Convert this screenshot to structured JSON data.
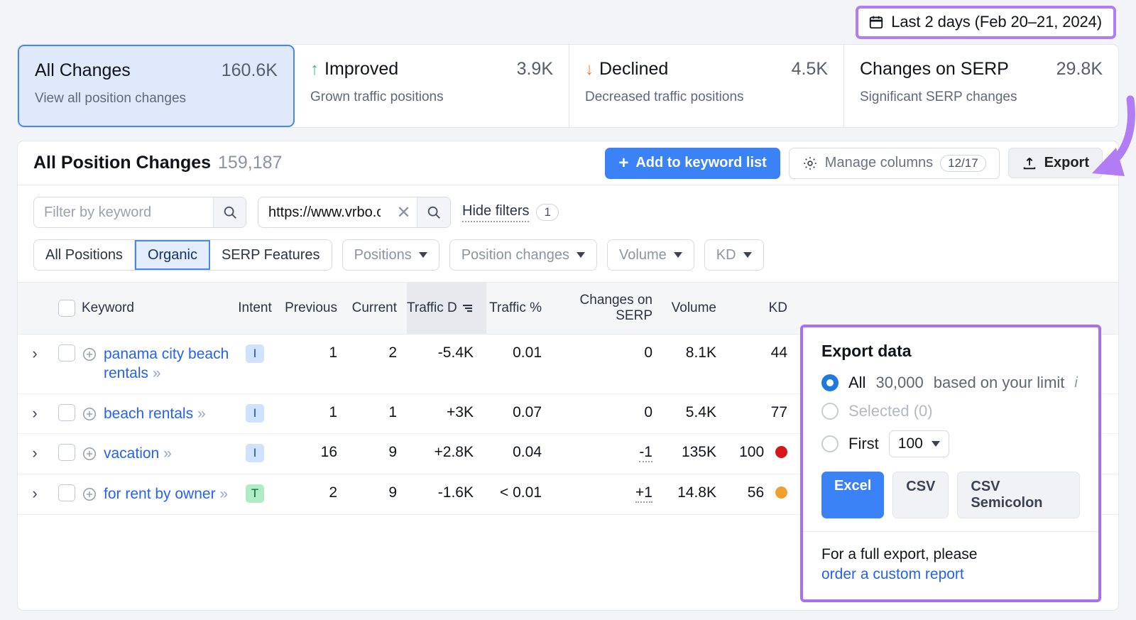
{
  "date_filter": {
    "label": "Last 2 days (Feb 20–21, 2024)",
    "icon": "calendar-icon"
  },
  "cards": [
    {
      "title": "All Changes",
      "value": "160.6K",
      "subtitle": "View all position changes",
      "arrow": "",
      "active": true
    },
    {
      "title": "Improved",
      "value": "3.9K",
      "subtitle": "Grown traffic positions",
      "arrow": "↑",
      "active": false
    },
    {
      "title": "Declined",
      "value": "4.5K",
      "subtitle": "Decreased traffic positions",
      "arrow": "↓",
      "active": false
    },
    {
      "title": "Changes on SERP",
      "value": "29.8K",
      "subtitle": "Significant SERP changes",
      "arrow": "",
      "active": false
    }
  ],
  "panel": {
    "title": "All Position Changes",
    "count": "159,187",
    "add_to_list": "Add to keyword list",
    "manage_columns": "Manage columns",
    "manage_columns_badge": "12/17",
    "export": "Export"
  },
  "filters": {
    "keyword_placeholder": "Filter by keyword",
    "keyword_value": "",
    "url_value": "https://www.vrbo.com/",
    "hide_filters": "Hide filters",
    "hide_filters_count": "1",
    "segments": [
      {
        "label": "All Positions",
        "on": false
      },
      {
        "label": "Organic",
        "on": true
      },
      {
        "label": "SERP Features",
        "on": false
      }
    ],
    "dropdowns": [
      "Positions",
      "Position changes",
      "Volume",
      "KD"
    ]
  },
  "table": {
    "columns": [
      {
        "label": "Keyword",
        "key": "keyword"
      },
      {
        "label": "Intent",
        "key": "intent"
      },
      {
        "label": "Previous",
        "key": "previous"
      },
      {
        "label": "Current",
        "key": "current"
      },
      {
        "label": "Traffic D",
        "key": "traffic_d",
        "sorted": true
      },
      {
        "label": "Traffic %",
        "key": "traffic_pct"
      },
      {
        "label": "Changes on SERP",
        "key": "changes_serp"
      },
      {
        "label": "Volume",
        "key": "volume"
      },
      {
        "label": "KD",
        "key": "kd"
      }
    ],
    "rows": [
      {
        "keyword": "panama city beach rentals",
        "intent": "I",
        "intent_type": "i",
        "previous": "1",
        "current": "2",
        "traffic_d": "-5.4K",
        "traffic_pct": "0.01",
        "changes_serp": "0",
        "changes_serp_link": false,
        "volume": "8.1K",
        "kd": "44",
        "kd_color": "",
        "url": ""
      },
      {
        "keyword": "beach rentals",
        "intent": "I",
        "intent_type": "i",
        "previous": "1",
        "current": "1",
        "traffic_d": "+3K",
        "traffic_pct": "0.07",
        "changes_serp": "0",
        "changes_serp_link": false,
        "volume": "5.4K",
        "kd": "77",
        "kd_color": "",
        "url": ""
      },
      {
        "keyword": "vacation",
        "intent": "I",
        "intent_type": "i",
        "previous": "16",
        "current": "9",
        "traffic_d": "+2.8K",
        "traffic_pct": "0.04",
        "changes_serp": "-1",
        "changes_serp_link": true,
        "volume": "135K",
        "kd": "100",
        "kd_color": "#d41818",
        "url": "www.vrbo.com/"
      },
      {
        "keyword": "for rent by owner",
        "intent": "T",
        "intent_type": "t",
        "previous": "2",
        "current": "9",
        "traffic_d": "-1.6K",
        "traffic_pct": "< 0.01",
        "changes_serp": "+1",
        "changes_serp_link": true,
        "volume": "14.8K",
        "kd": "56",
        "kd_color": "#f0a02e",
        "url": "www.vrbo.com/"
      }
    ]
  },
  "export_popup": {
    "title": "Export data",
    "option_all_prefix": "All",
    "option_all_value": "30,000",
    "option_all_suffix": "based on your limit",
    "option_selected": "Selected (0)",
    "option_first": "First",
    "first_value": "100",
    "formats": [
      {
        "label": "Excel",
        "on": true
      },
      {
        "label": "CSV",
        "on": false
      },
      {
        "label": "CSV Semicolon",
        "on": false
      }
    ],
    "footer_text": "For a full export, please",
    "footer_link": "order a custom report"
  },
  "colors": {
    "accent_blue": "#3b82f6",
    "highlight_purple": "#a770f2",
    "improved_green": "#3bb77e",
    "declined_orange": "#f07c2e"
  }
}
